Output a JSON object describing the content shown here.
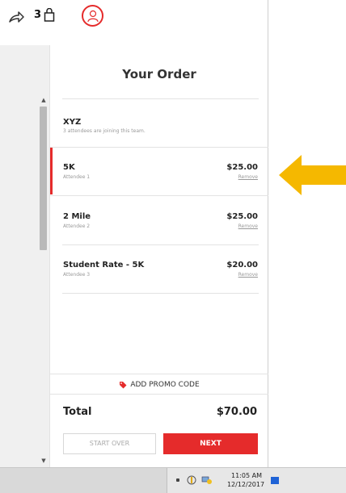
{
  "header": {
    "cart_count": "3"
  },
  "order": {
    "title": "Your Order",
    "team": {
      "name": "XYZ",
      "subtitle": "3 attendees are joining this team."
    },
    "items": [
      {
        "name": "5K",
        "attendee": "Attendee 1",
        "price": "$25.00",
        "remove_label": "Remove",
        "selected": true
      },
      {
        "name": "2 Mile",
        "attendee": "Attendee 2",
        "price": "$25.00",
        "remove_label": "Remove",
        "selected": false
      },
      {
        "name": "Student Rate - 5K",
        "attendee": "Attendee 3",
        "price": "$20.00",
        "remove_label": "Remove",
        "selected": false
      }
    ],
    "promo_label": "ADD PROMO CODE",
    "total_label": "Total",
    "total_value": "$70.00",
    "start_over_label": "START OVER",
    "next_label": "NEXT"
  },
  "taskbar": {
    "time": "11:05 AM",
    "date": "12/12/2017"
  },
  "colors": {
    "accent": "#e52b2b",
    "arrow": "#f5b800",
    "notification": "#1f63d6"
  },
  "icons": {
    "share": "share-arrow-icon",
    "bag": "shopping-bag-icon",
    "avatar": "user-avatar-icon",
    "tag": "price-tag-icon",
    "arrow": "yellow-pointer-arrow"
  }
}
